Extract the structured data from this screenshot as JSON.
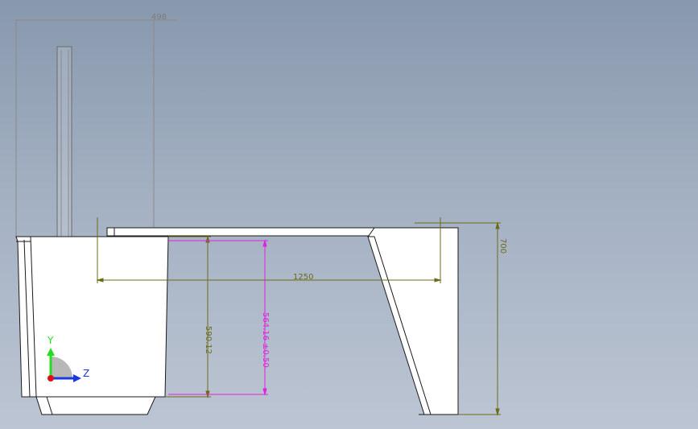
{
  "view": {
    "background_top": "#8898ad",
    "background_bottom": "#bcc5d3"
  },
  "colors": {
    "dimension": "#6b6b18",
    "dimension_highlight": "#e020e0",
    "model_edge": "#1a1a1a",
    "model_face": "#ffffff",
    "sketch_line": "#8a8a8a"
  },
  "dimensions": {
    "top_width": "498",
    "span": "1250",
    "height_right": "700",
    "height_left": "590.12",
    "height_pink": "564.16 ±0.50"
  },
  "triad": {
    "y_label": "Y",
    "z_label": "Z",
    "icon": "coordinate-triad-icon"
  }
}
